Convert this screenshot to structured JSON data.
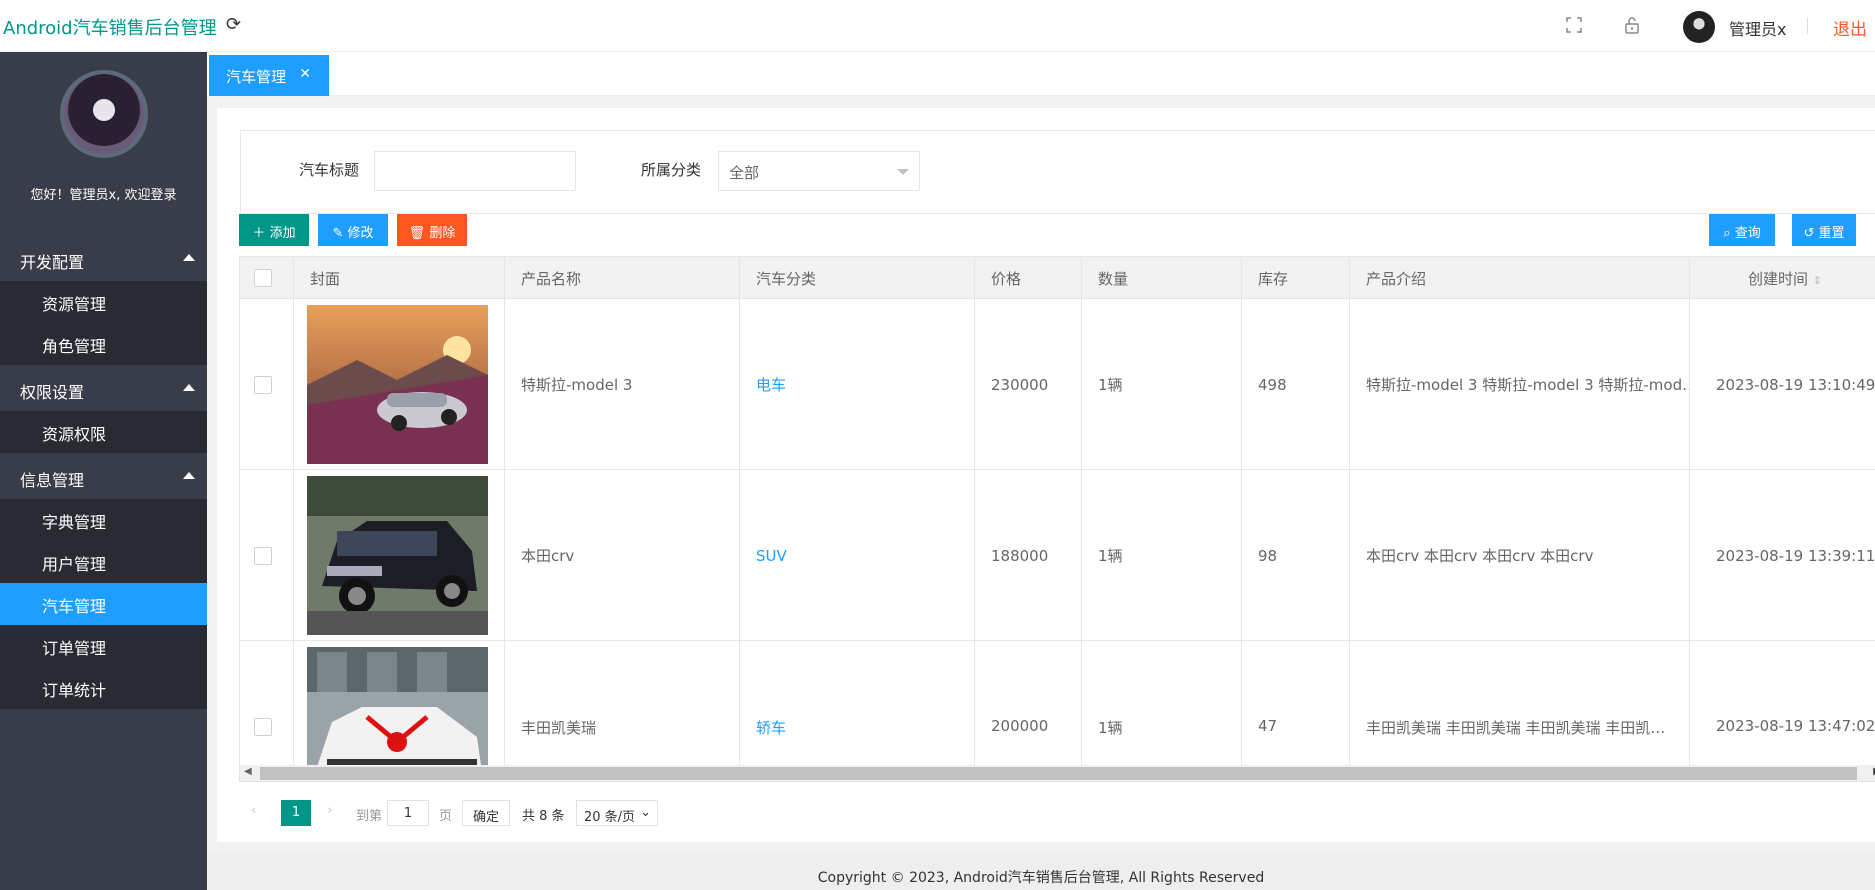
{
  "header": {
    "brand": "Android汽车销售后台管理",
    "user": "管理员x",
    "logout": "退出"
  },
  "sidebar": {
    "welcome": "您好！管理员x, 欢迎登录",
    "groups": [
      {
        "label": "开发配置",
        "items": [
          "资源管理",
          "角色管理"
        ]
      },
      {
        "label": "权限设置",
        "items": [
          "资源权限"
        ]
      },
      {
        "label": "信息管理",
        "items": [
          "字典管理",
          "用户管理",
          "汽车管理",
          "订单管理",
          "订单统计"
        ]
      }
    ],
    "active_item": "汽车管理"
  },
  "tabs": [
    {
      "label": "汽车管理",
      "close": "✕"
    }
  ],
  "search": {
    "title_label": "汽车标题",
    "title_value": "",
    "category_label": "所属分类",
    "category_value": "全部"
  },
  "toolbar": {
    "add": "添加",
    "edit": "修改",
    "delete": "删除",
    "query": "查询",
    "reset": "重置"
  },
  "table": {
    "columns": [
      "封面",
      "产品名称",
      "汽车分类",
      "价格",
      "数量",
      "库存",
      "产品介绍",
      "创建时间"
    ],
    "rows": [
      {
        "name": "特斯拉-model 3",
        "category": "电车",
        "price": "230000",
        "qty": "1辆",
        "stock": "498",
        "intro": "特斯拉-model 3 特斯拉-model 3 特斯拉-mod…",
        "created": "2023-08-19 13:10:49"
      },
      {
        "name": "本田crv",
        "category": "SUV",
        "price": "188000",
        "qty": "1辆",
        "stock": "98",
        "intro": "本田crv 本田crv 本田crv 本田crv",
        "created": "2023-08-19 13:39:11"
      },
      {
        "name": "丰田凯美瑞",
        "category": "轿车",
        "price": "200000",
        "qty": "1辆",
        "stock": "47",
        "intro": "丰田凯美瑞 丰田凯美瑞 丰田凯美瑞 丰田凯…",
        "created": "2023-08-19 13:47:02"
      }
    ]
  },
  "pager": {
    "current": "1",
    "goto_label": "到第",
    "goto_value": "1",
    "page_unit": "页",
    "confirm": "确定",
    "total": "共 8 条",
    "per_page": "20 条/页"
  },
  "footer": "Copyright © 2023, Android汽车销售后台管理, All Rights Reserved",
  "colors": {
    "accent": "#009688",
    "blue": "#1e9fff",
    "danger": "#ff5722",
    "sidebar": "#393d49"
  }
}
